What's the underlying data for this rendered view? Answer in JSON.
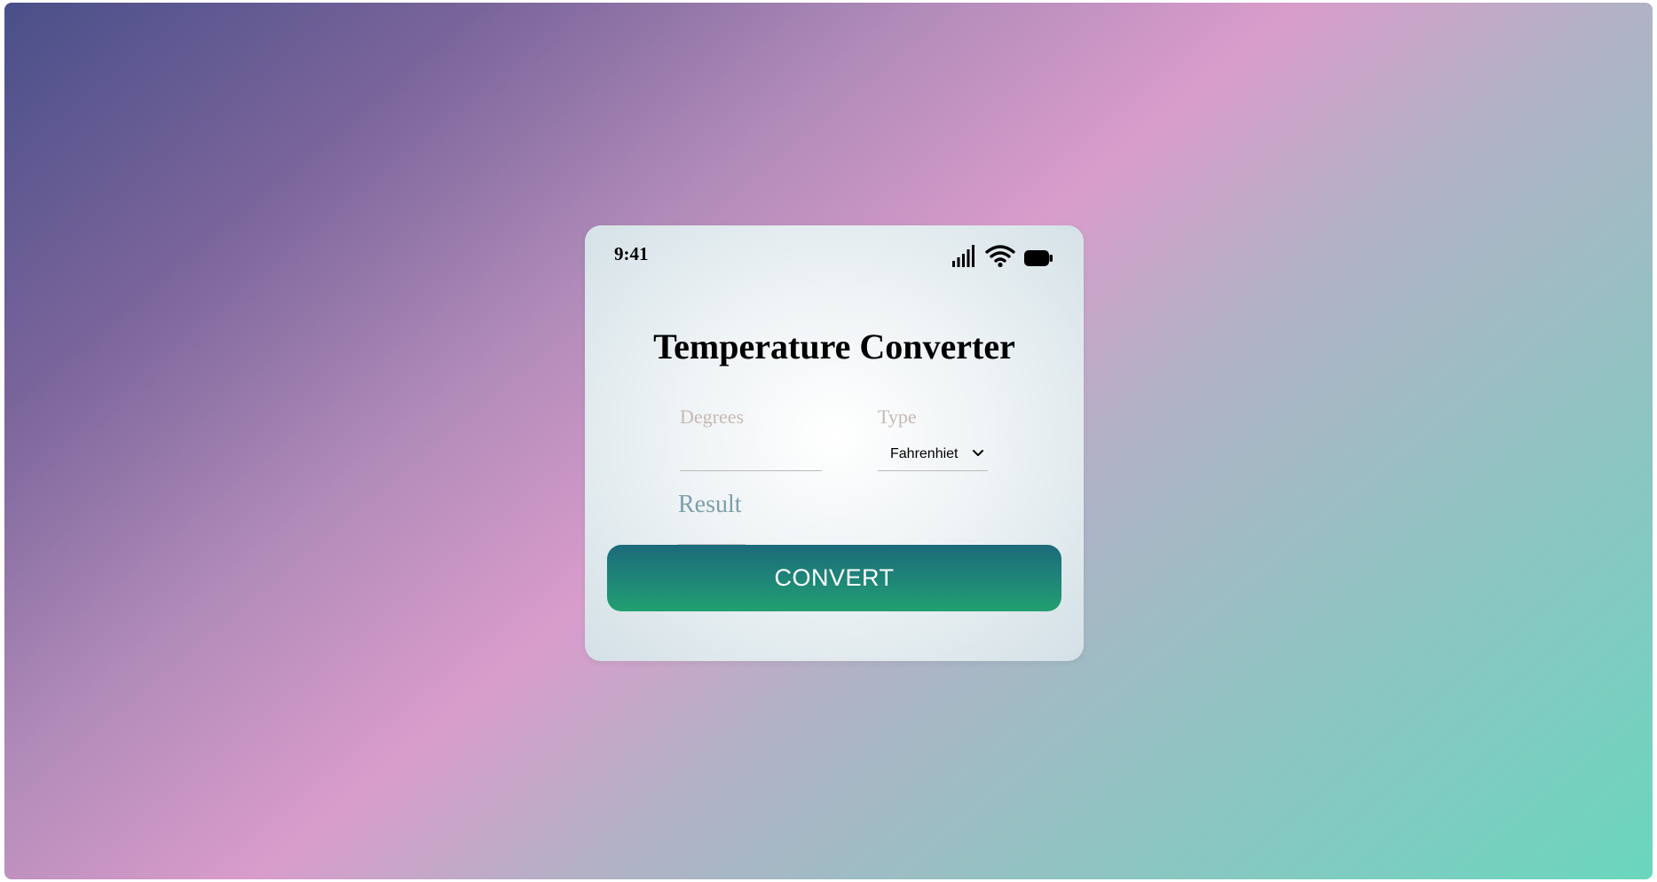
{
  "status_bar": {
    "time": "9:41",
    "icons": [
      "signal-icon",
      "wifi-icon",
      "battery-icon"
    ]
  },
  "app": {
    "title": "Temperature Converter",
    "degrees": {
      "label": "Degrees",
      "value": ""
    },
    "type": {
      "label": "Type",
      "selected": "Fahrenhiet"
    },
    "result": {
      "label": "Result"
    },
    "convert_label": "CONVERT"
  },
  "colors": {
    "button_gradient_top": "#1c6a7a",
    "button_gradient_bottom": "#22a070",
    "label_color": "#c7b8b4",
    "result_color": "#7e9faa",
    "background_start": "#4a4f89",
    "background_mid": "#d99ccb",
    "background_end": "#6ad6bd"
  }
}
